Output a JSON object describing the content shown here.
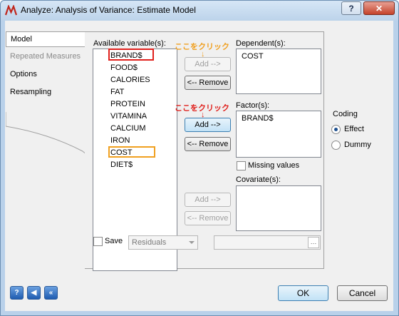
{
  "window": {
    "title": "Analyze: Analysis of Variance: Estimate Model",
    "help_label": "?",
    "close_label": "✕"
  },
  "tabs": [
    {
      "label": "Model",
      "state": "active"
    },
    {
      "label": "Repeated Measures",
      "state": "disabled"
    },
    {
      "label": "Options",
      "state": "normal"
    },
    {
      "label": "Resampling",
      "state": "normal"
    }
  ],
  "available": {
    "label": "Available variable(s):",
    "items": [
      "BRAND$",
      "FOOD$",
      "CALORIES",
      "FAT",
      "PROTEIN",
      "VITAMINA",
      "CALCIUM",
      "IRON",
      "COST",
      "DIET$"
    ]
  },
  "dependent": {
    "label": "Dependent(s):",
    "items": [
      "COST"
    ],
    "add_label": "Add -->",
    "remove_label": "<-- Remove"
  },
  "factor": {
    "label": "Factor(s):",
    "items": [
      "BRAND$"
    ],
    "add_label": "Add -->",
    "remove_label": "<-- Remove"
  },
  "covariate": {
    "label": "Covariate(s):",
    "add_label": "Add -->",
    "remove_label": "<-- Remove"
  },
  "missing_values_label": "Missing values",
  "coding": {
    "label": "Coding",
    "options": [
      "Effect",
      "Dummy"
    ],
    "selected": "Effect"
  },
  "save": {
    "label": "Save",
    "selected": "Residuals"
  },
  "annotations": {
    "top": "ここをクリック",
    "middle": "ここをクリック",
    "arrow": "↓",
    "top_color": "#f0a020",
    "middle_color": "#e0201c"
  },
  "buttons": {
    "ok": "OK",
    "cancel": "Cancel"
  },
  "nav_icons": [
    "help-icon",
    "back-icon",
    "first-icon"
  ]
}
